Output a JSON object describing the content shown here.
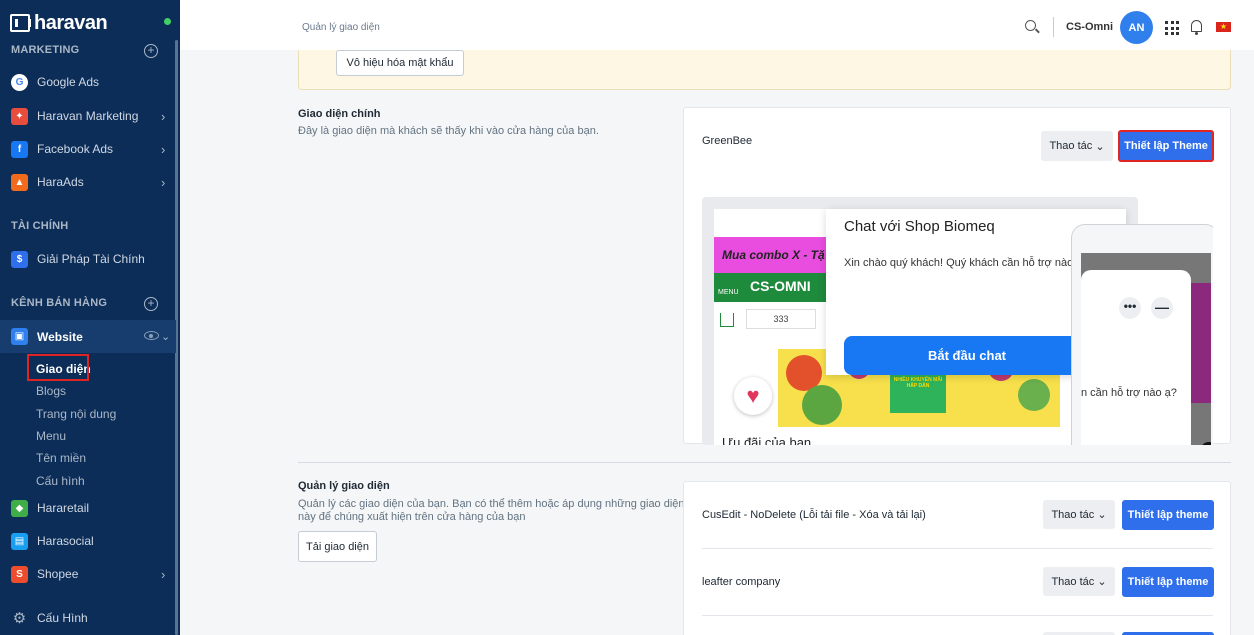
{
  "sidebar": {
    "logo_text": "haravan",
    "sections": {
      "marketing": "MARKETING",
      "finance": "TÀI CHÍNH",
      "channels": "KÊNH BÁN HÀNG"
    },
    "items": {
      "google_ads": "Google Ads",
      "haravan_marketing": "Haravan Marketing",
      "facebook_ads": "Facebook Ads",
      "haraads": "HaraAds",
      "finance_solution": "Giải Pháp Tài Chính",
      "website": "Website",
      "hararetail": "Hararetail",
      "harasocial": "Harasocial",
      "shopee": "Shopee",
      "config": "Cấu Hình"
    },
    "website_sub": {
      "themes": "Giao diện",
      "blogs": "Blogs",
      "pages": "Trang nội dung",
      "menu": "Menu",
      "domains": "Tên miền",
      "settings": "Cấu hình"
    }
  },
  "header": {
    "breadcrumb": "Quản lý giao diện",
    "store_name": "CS-Omni",
    "avatar_initials": "AN",
    "flag_star": "★"
  },
  "notice": {
    "disable_password_button": "Vô hiệu hóa mật khẩu"
  },
  "main_theme": {
    "title": "Giao diện chính",
    "description": "Đây là giao diện mà khách sẽ thấy khi vào cửa hàng của bạn.",
    "theme_name": "GreenBee",
    "actions_button": "Thao tác",
    "setup_button": "Thiết lập Theme",
    "preview": {
      "promo_text": "Mua combo X - Tặ",
      "store_brand": "CS-OMNI",
      "menu_label": "MENU",
      "counter": "333",
      "banner_text": "NHIỀU KHUYẾN MÃI HẤP DẪN",
      "heart": "♥",
      "deals_heading": "Ưu đãi của bạn",
      "chat_title": "Chat với Shop Biomeq",
      "chat_welcome": "Xin chào quý khách! Quý khách cần hỗ trợ nào",
      "chat_start_button": "Bắt đầu chat",
      "phone_dots": "•••",
      "phone_min": "—",
      "phone_text": "n cần hỗ trợ nào ạ?",
      "phone_close": "✕"
    }
  },
  "manage_themes": {
    "title": "Quản lý giao diện",
    "description_line1": "Quản lý các giao diện của bạn. Bạn có thể thêm hoặc áp dụng những giao diện",
    "description_line2": "này để chúng xuất hiện trên cửa hàng của bạn",
    "upload_button": "Tải giao diện",
    "themes": [
      {
        "name": "CusEdit - NoDelete (Lỗi tải file - Xóa và tải lại)",
        "actions": "Thao tác",
        "setup": "Thiết lập theme"
      },
      {
        "name": "leafter company",
        "actions": "Thao tác",
        "setup": "Thiết lập theme"
      }
    ]
  },
  "colors": {
    "sidebar_bg": "#0c2d57",
    "primary": "#2f6feb",
    "highlight": "#e02424"
  }
}
